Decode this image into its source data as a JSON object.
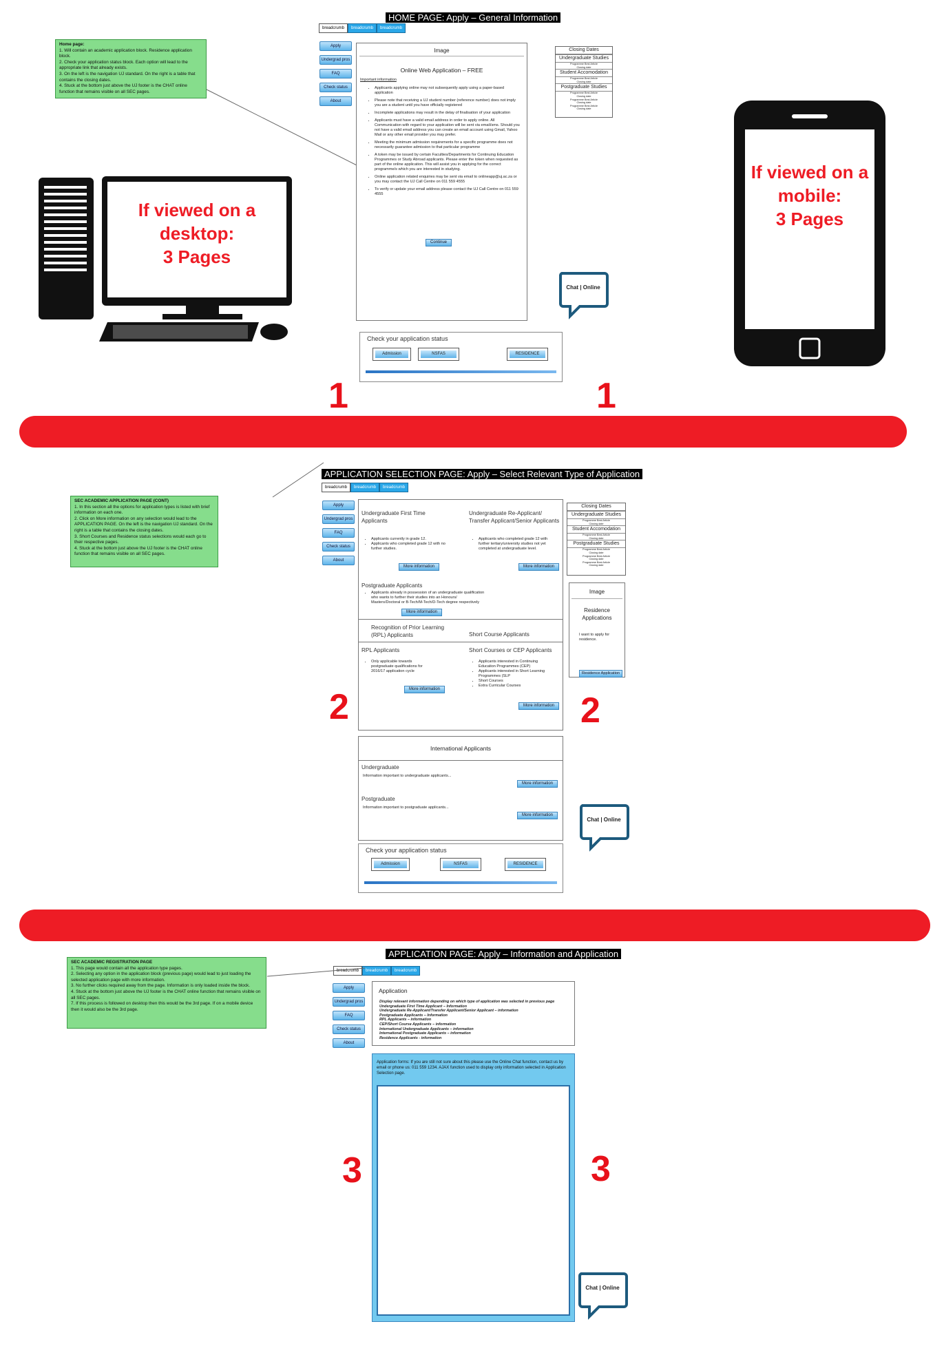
{
  "page1": {
    "title": "HOME PAGE: Apply – General Information",
    "breadcrumbs": [
      "breadcrumb",
      "breadcrumb",
      "breadcrumb"
    ],
    "nav": [
      "Apply",
      "Undergrad pros",
      "FAQ",
      "Check status",
      "About"
    ],
    "note": {
      "title": "Home page:",
      "lines": [
        "1. Will contain an academic application block. Residence application block.",
        "2. Check your application status block.   Each option will lead to the appropriate link that already exists.",
        "3. On the left is the navigation UJ standard. On the right is a table that contains the closing dates.",
        "4. Stuck at the bottom just above the UJ footer is the CHAT online function that remains visible on all SEC pages."
      ]
    },
    "main": {
      "image_label": "Image",
      "heading": "Online Web Application – FREE",
      "subheading": "Important information",
      "bullets": [
        "Applicants applying online may not subsequently apply using a paper-based application",
        "Please note that receiving a UJ student number (reference number) does not imply you are a student until you have officially registered",
        "Incomplete applications may result in the delay of finalisation of your application",
        "Applicants must have a valid email address in order to apply online. All Communication with regard to your application will be sent via email/sms. Should you not have a valid email address you can create an email account using Gmail, Yahoo Mail or any other email provider you may prefer.",
        "Meeting the minimum admission requirements for a specific programme does not necessarily guarantee admission to that particular programme",
        "A token may be issued by certain Faculties/Departments for Continuing Education Programmes or Study Abroad applicants. Please enter the token when requested as part of the online application. This will assist you in applying for the correct programme/s which you are interested in studying.",
        "Online application related enquiries may be sent via email to onlineapp@uj.ac.za or you may contact the UJ Call Centre on 011 559 4555",
        "To verify or update your email address please contact the UJ Call Centre on 011 559 4555"
      ],
      "continue": "Continue"
    },
    "closing": {
      "head": "Closing Dates",
      "sections": [
        "Undergraduate Studies",
        "Student Accomodation",
        "Postgraduate Studies"
      ],
      "item": "Programme Best Article",
      "item2": "Closing date"
    },
    "status": {
      "title": "Check your application status",
      "buttons": [
        "Admission",
        "NSFAS",
        "RESIDENCE"
      ]
    },
    "chat": "Chat | Online",
    "desktop_text": [
      "If viewed on a",
      "desktop:",
      "3 Pages"
    ],
    "mobile_text": [
      "If viewed on a",
      "mobile:",
      "3 Pages"
    ],
    "num_left": "1",
    "num_right": "1"
  },
  "page2": {
    "title": "APPLICATION SELECTION PAGE: Apply – Select Relevant Type of Application",
    "breadcrumbs": [
      "breadcrumb",
      "breadcrumb",
      "breadcrumb"
    ],
    "nav": [
      "Apply",
      "Undergrad pros",
      "FAQ",
      "Check status",
      "About"
    ],
    "note": {
      "title": "SEC ACADEMIC APPLICATION PAGE (CONT)",
      "lines": [
        "1. In this section all the options for application types is listed with brief information on each one.",
        "2. Click on More information on any selection would lead to the APPLICATION PAGE. On the left is the navigation UJ standard. On the right is a table that contains the closing dates.",
        "3. Short Courses and Residence status selections would each go to their respective pages.",
        "4. Stuck at the bottom just above the UJ footer is the CHAT online function that remains visible on all SEC pages."
      ]
    },
    "ug_first": {
      "title": "Undergraduate First Time Applicants",
      "bullets": [
        "Applicants currently in grade 12.",
        "Applicants who completed grade 12 with no further studies."
      ]
    },
    "ug_re": {
      "title": "Undergraduate Re-Applicant/ Transfer Applicant/Senior Applicants",
      "bullets": [
        "Applicants who completed grade 12 with further tertiary/university studies not yet completed at undergraduate level."
      ]
    },
    "pg": {
      "title": "Postgraduate Applicants",
      "bullets": [
        "Applicants already in possession of an undergraduate qualification who wants to further their studies into an Honours/ Masters/Doctoral or B-Tech/M-Tech/D-Tech degree respectively"
      ]
    },
    "rpl_head": "Recognition of Prior Learning (RPL) Applicants",
    "short_head": "Short Course Applicants",
    "rpl": {
      "title": "RPL Applicants",
      "bullets": [
        "Only applicable towards postgraduate qualifications for 2016/17 application cycle"
      ]
    },
    "short": {
      "title": "Short Courses or CEP Applicants",
      "bullets": [
        "Applicants interested in Continuing Education Programmes (CEP)",
        "Applicants interested in Short Learning Programmes (SLP",
        "Short Courses",
        "Extra Curricular Courses"
      ]
    },
    "more": "More information",
    "closing": {
      "head": "Closing Dates",
      "sections": [
        "Undergraduate Studies",
        "Student Accomodation",
        "Postgraduate Studies"
      ],
      "item": "Programme Best Article",
      "item2": "Closing date"
    },
    "residence": {
      "image": "Image",
      "title": "Residence Applications",
      "text": "I want to apply for residence.",
      "button": "Residence Application"
    },
    "intl": {
      "title": "International Applicants",
      "ug": "Undergraduate",
      "ug_text": "Information important to undergraduate applicants...",
      "pg": "Postgraduate",
      "pg_text": "Information important to postgraduate applicants..."
    },
    "status": {
      "title": "Check your application status",
      "buttons": [
        "Admission",
        "NSFAS",
        "RESIDENCE"
      ]
    },
    "chat": "Chat | Online",
    "num_left": "2",
    "num_right": "2"
  },
  "page3": {
    "title": "APPLICATION PAGE: Apply – Information and Application",
    "breadcrumbs": [
      "breadcrumb",
      "breadcrumb",
      "breadcrumb"
    ],
    "nav": [
      "Apply",
      "Undergrad pros",
      "FAQ",
      "Check status",
      "About"
    ],
    "note": {
      "title": "SEC ACADEMIC REGISTRATION PAGE",
      "lines": [
        "1. This page would contain all the application type pages.",
        "2. Selecting any option in the application block (previous page) would lead to just loading the selected application page with more information.",
        "3. No further clicks required away from the page. Information is only loaded inside the block.",
        "4. Stuck at the bottom just above the UJ footer is the CHAT online function that remains visible on all SEC pages.",
        "7. If this process is followed on desktop then this would be the 3rd page. If on a mobile device then it would also be the 3rd page."
      ]
    },
    "app": {
      "title": "Application",
      "lines": [
        "Display relevant information depending on which type of application was selected in previous page",
        "Undergraduate First Time Applicant – Information",
        "Undergraduate Re-Applicant/Transfer Applicant/Senior Applicant – information",
        "Postgraduate Applicants – Information",
        "RPL Applicants – information",
        "CEP/Short Course Applicants – information",
        "International Undergraduate Applicants – information",
        "International Postgraduate Applicants – information",
        "Residence Applicants - information"
      ]
    },
    "form_text": "Application forms: If you are still not sure about this please use the Online Chat function, contact us by email or phone us: 011 559 1234.  AJAX function used to display only information selected in Application Selection page.",
    "chat": "Chat | Online",
    "num_left": "3",
    "num_right": "3"
  }
}
